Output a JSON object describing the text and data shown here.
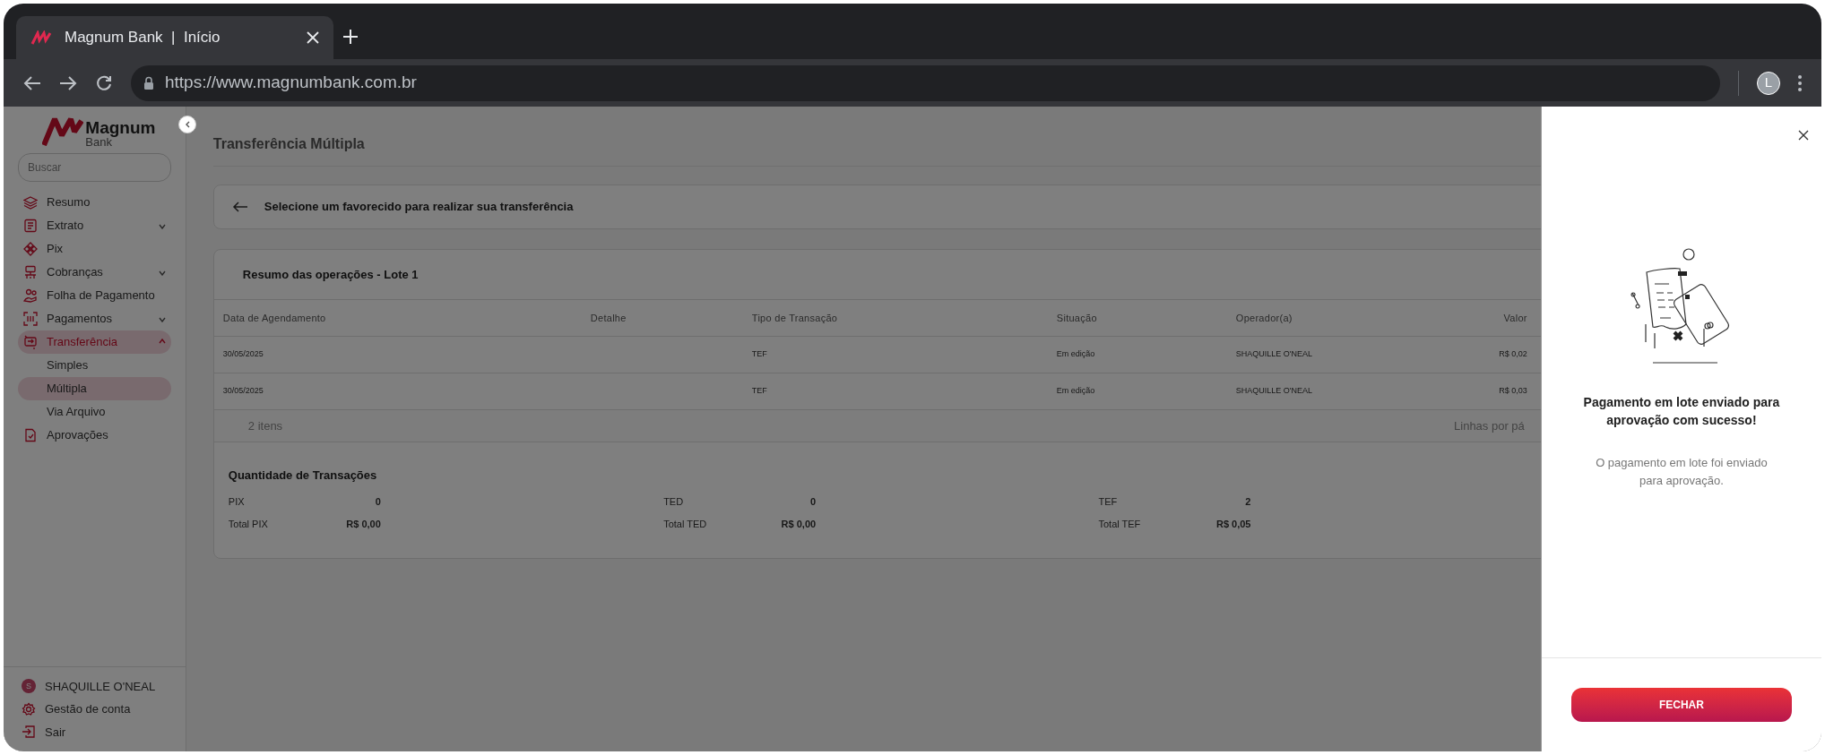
{
  "browser": {
    "tab_title": "Magnum Bank  |  Início",
    "url": "https://www.magnumbank.com.br",
    "profile_initial": "L"
  },
  "sidebar": {
    "logo": {
      "name": "Magnum",
      "sub": "Bank"
    },
    "search": {
      "placeholder": "Buscar"
    },
    "items": [
      {
        "label": "Resumo",
        "selected": false
      },
      {
        "label": "Extrato",
        "expanded": false,
        "selected": false
      },
      {
        "label": "Pix",
        "selected": false
      },
      {
        "label": "Cobranças",
        "expanded": false,
        "selected": false
      },
      {
        "label": "Folha de Pagamento",
        "selected": false
      },
      {
        "label": "Pagamentos",
        "expanded": false,
        "selected": false
      },
      {
        "label": "Transferência",
        "expanded": true,
        "selected": true,
        "children": [
          {
            "label": "Simples",
            "selected": false
          },
          {
            "label": "Múltipla",
            "selected": true
          },
          {
            "label": "Via Arquivo",
            "selected": false
          }
        ]
      },
      {
        "label": "Aprovações",
        "selected": false
      }
    ],
    "user": {
      "initial": "S",
      "name": "SHAQUILLE O'NEAL"
    },
    "footer_items": [
      "Gestão de conta",
      "Sair"
    ]
  },
  "page": {
    "title": "Transferência Múltipla",
    "step": "Selecione um favorecido para realizar sua transferência",
    "batch": {
      "title": "Resumo das operações - Lote 1",
      "columns": [
        "Data de Agendamento",
        "Detalhe",
        "Tipo de Transação",
        "Situação",
        "Operador(a)",
        "Valor"
      ],
      "rows": [
        [
          "30/05/2025",
          "",
          "TEF",
          "Em edição",
          "SHAQUILLE O'NEAL",
          "R$ 0,02"
        ],
        [
          "30/05/2025",
          "",
          "TEF",
          "Em edição",
          "SHAQUILLE O'NEAL",
          "R$ 0,03"
        ]
      ],
      "count": "2 itens",
      "rows_per_page": "Linhas por pá"
    },
    "totals": {
      "title": "Quantidade de Transações",
      "groups": [
        {
          "label": "PIX",
          "count": "0",
          "total_label": "Total PIX",
          "total": "R$ 0,00"
        },
        {
          "label": "TED",
          "count": "0",
          "total_label": "Total TED",
          "total": "R$ 0,00"
        },
        {
          "label": "TEF",
          "count": "2",
          "total_label": "Total TEF",
          "total": "R$ 0,05"
        }
      ]
    }
  },
  "panel": {
    "title": "Pagamento em lote enviado para aprovação com sucesso!",
    "message": "O pagamento em lote foi enviado para aprovação.",
    "button": "FECHAR"
  }
}
